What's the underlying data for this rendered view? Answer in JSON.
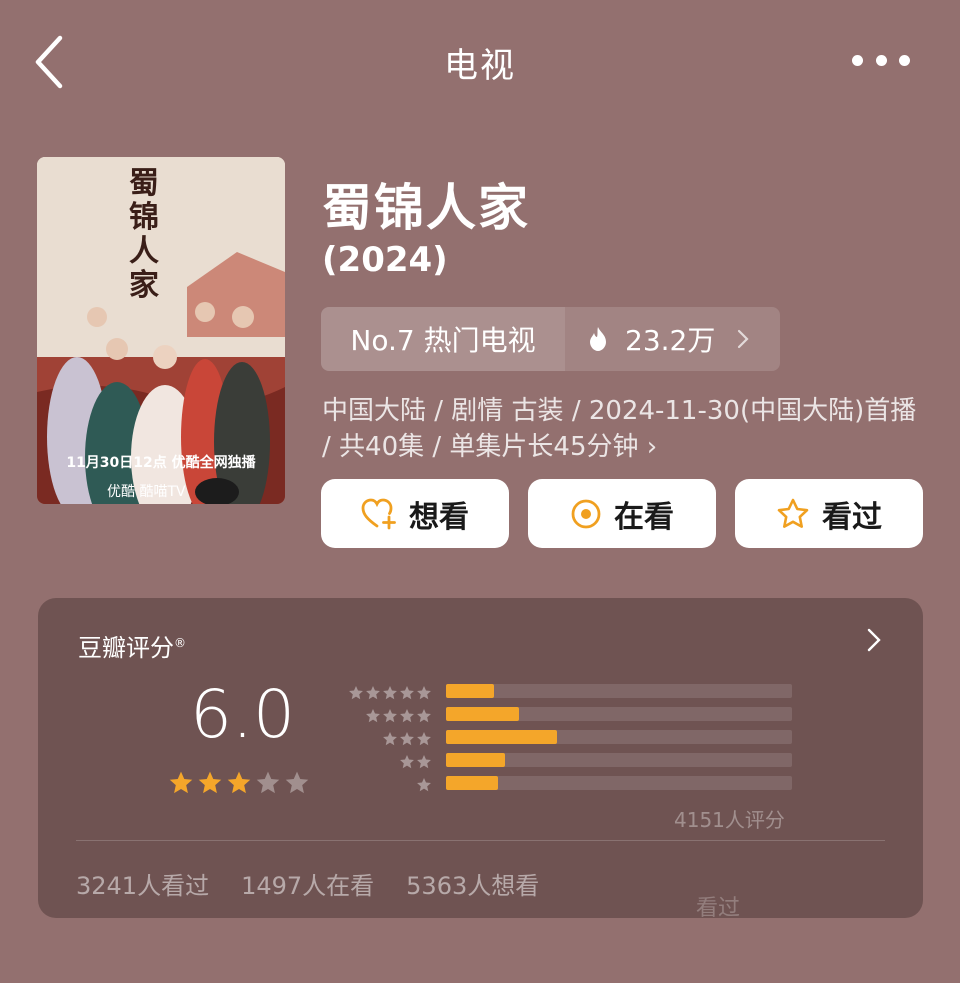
{
  "nav": {
    "title": "电视"
  },
  "poster": {
    "title_art": "蜀锦人家",
    "caption": "11月30日12点 优酷全网独播",
    "platforms": "优酷  酷喵TV"
  },
  "movie": {
    "title": "蜀锦人家",
    "year": "(2024)",
    "rank_label": "No.7 热门电视",
    "heat": "23.2万",
    "meta": "中国大陆 / 剧情 古装 / 2024-11-30(中国大陆)首播 / 共40集 / 单集片长45分钟 ›"
  },
  "actions": [
    {
      "label": "想看",
      "icon": "heart-plus-icon"
    },
    {
      "label": "在看",
      "icon": "target-icon"
    },
    {
      "label": "看过",
      "icon": "star-outline-icon"
    }
  ],
  "rating": {
    "title": "豆瓣评分",
    "trademark": "®",
    "score": "6.0",
    "stars": 3,
    "distribution": [
      {
        "stars": 5,
        "fraction": 0.14
      },
      {
        "stars": 4,
        "fraction": 0.21
      },
      {
        "stars": 3,
        "fraction": 0.32
      },
      {
        "stars": 2,
        "fraction": 0.17
      },
      {
        "stars": 1,
        "fraction": 0.15
      }
    ],
    "raters": "4151人评分",
    "counts": {
      "watched": "3241人看过",
      "watching": "1497人在看",
      "want": "5363人想看"
    }
  },
  "colors": {
    "background": "#93706f",
    "card": "#6f5352",
    "accent": "#f4a62a"
  },
  "watermark": "看过"
}
